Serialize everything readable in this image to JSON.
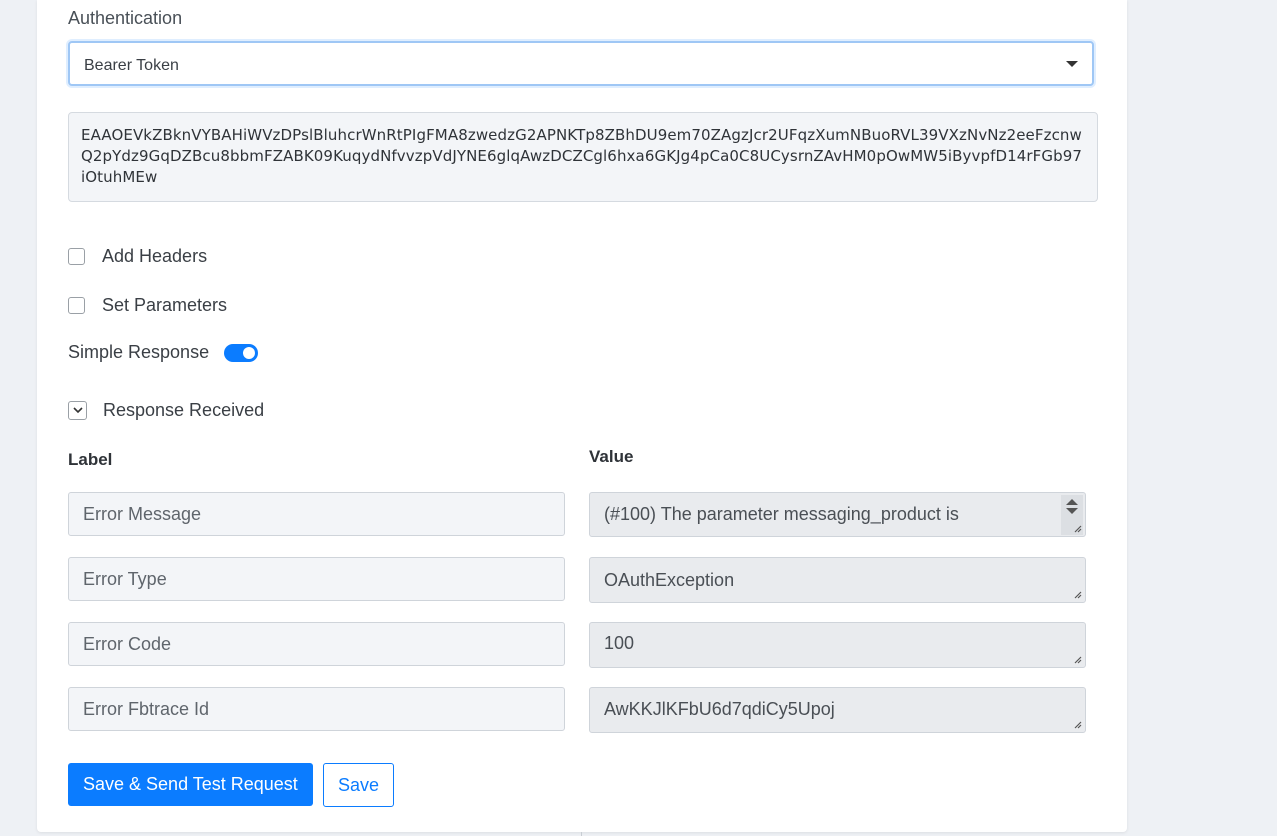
{
  "auth": {
    "label": "Authentication",
    "selected": "Bearer Token",
    "token": "EAAOEVkZBknVYBAHiWVzDPslBluhcrWnRtPIgFMA8zwedzG2APNKTp8ZBhDU9em70ZAgzJcr2UFqzXumNBuoRVL39VXzNvNz2eeFzcnwQ2pYdz9GqDZBcu8bbmFZABK09KuqydNfvvzpVdJYNE6glqAwzDCZCgl6hxa6GKJg4pCa0C8UCysrnZAvHM0pOwMW5iByvpfD14rFGb97iOtuhMEw"
  },
  "options": {
    "add_headers": "Add Headers",
    "set_parameters": "Set Parameters",
    "simple_response": "Simple Response",
    "simple_response_on": true,
    "response_received": "Response Received"
  },
  "table": {
    "label_header": "Label",
    "value_header": "Value",
    "rows": [
      {
        "label": "Error Message",
        "value": "(#100) The parameter messaging_product is"
      },
      {
        "label": "Error Type",
        "value": "OAuthException"
      },
      {
        "label": "Error Code",
        "value": "100"
      },
      {
        "label": "Error Fbtrace Id",
        "value": "AwKKJlKFbU6d7qdiCy5Upoj"
      }
    ]
  },
  "buttons": {
    "save_send": "Save & Send Test Request",
    "save": "Save"
  },
  "colors": {
    "accent": "#0b7cff",
    "field_bg": "#f3f5f8",
    "readonly_bg": "#e9ebee"
  }
}
